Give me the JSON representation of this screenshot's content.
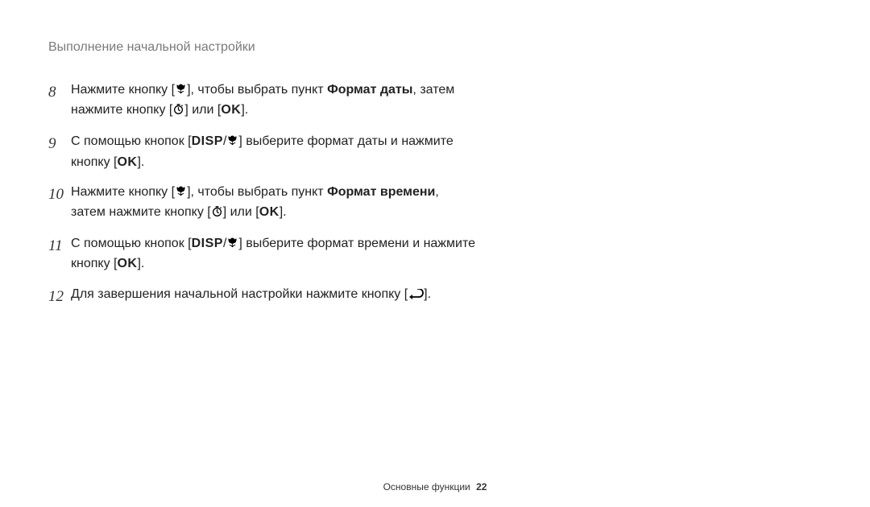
{
  "header": {
    "title": "Выполнение начальной настройки"
  },
  "icons": {
    "macro": "macro-icon",
    "timer": "timer-icon",
    "ok": "OK",
    "disp": "DISP",
    "back": "back-icon"
  },
  "steps": [
    {
      "num": "8",
      "parts": [
        "Нажмите кнопку [",
        "{macro}",
        "], чтобы выбрать пункт ",
        "{b}Формат даты{/b}",
        ", затем нажмите кнопку [",
        "{timer}",
        "] или [",
        "{ok}",
        "]."
      ]
    },
    {
      "num": "9",
      "parts": [
        "С помощью кнопок [",
        "{disp}",
        "/",
        "{macro}",
        "] выберите формат даты и нажмите кнопку [",
        "{ok}",
        "]."
      ]
    },
    {
      "num": "10",
      "parts": [
        "Нажмите кнопку [",
        "{macro}",
        "], чтобы выбрать пункт ",
        "{b}Формат времени{/b}",
        ", затем нажмите кнопку [",
        "{timer}",
        "] или [",
        "{ok}",
        "]."
      ]
    },
    {
      "num": "11",
      "parts": [
        "С помощью кнопок [",
        "{disp}",
        "/",
        "{macro}",
        "] выберите формат времени и нажмите кнопку [",
        "{ok}",
        "]."
      ]
    },
    {
      "num": "12",
      "parts": [
        "Для завершения начальной настройки нажмите кнопку [",
        "{back}",
        "]."
      ]
    }
  ],
  "footer": {
    "label": "Основные функции",
    "page": "22"
  }
}
